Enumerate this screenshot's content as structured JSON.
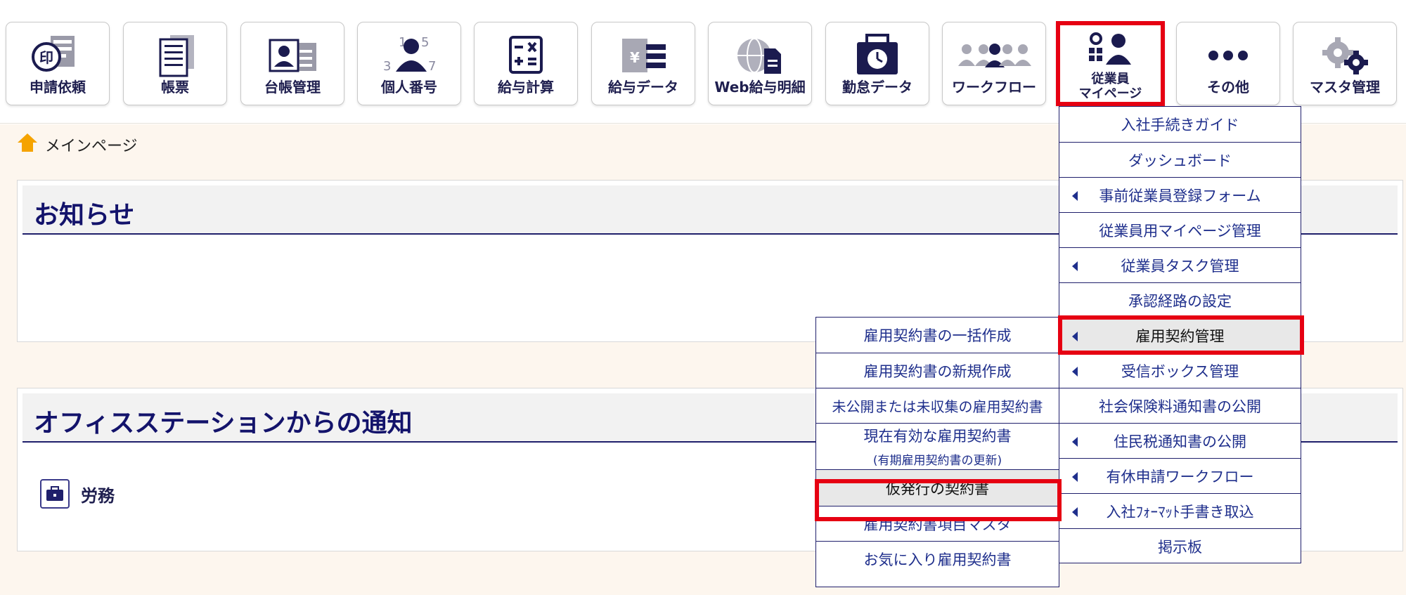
{
  "toolbar": {
    "tiles": [
      {
        "label": "申請依頼",
        "icon": "seal-document-icon"
      },
      {
        "label": "帳票",
        "icon": "document-icon"
      },
      {
        "label": "台帳管理",
        "icon": "id-card-icon"
      },
      {
        "label": "個人番号",
        "icon": "person-number-icon"
      },
      {
        "label": "給与計算",
        "icon": "calculator-icon"
      },
      {
        "label": "給与データ",
        "icon": "yen-data-icon"
      },
      {
        "label": "Web給与明細",
        "icon": "web-payslip-icon"
      },
      {
        "label": "勤怠データ",
        "icon": "timecard-icon"
      },
      {
        "label": "ワークフロー",
        "icon": "workflow-people-icon"
      },
      {
        "label_line1": "従業員",
        "label_line2": "マイページ",
        "icon": "employee-gear-icon"
      },
      {
        "label": "その他",
        "icon": "more-dots-icon"
      },
      {
        "label": "マスタ管理",
        "icon": "gears-icon"
      }
    ]
  },
  "breadcrumb": {
    "home_label": "メインページ"
  },
  "panels": {
    "notice_title": "お知らせ",
    "os_title": "オフィスステーションからの通知",
    "os_category": "労務"
  },
  "employee_menu": {
    "items": [
      {
        "label": "入社手続きガイド",
        "arrow": false
      },
      {
        "label": "ダッシュボード",
        "arrow": false
      },
      {
        "label": "事前従業員登録フォーム",
        "arrow": true
      },
      {
        "label": "従業員用マイページ管理",
        "arrow": false
      },
      {
        "label": "従業員タスク管理",
        "arrow": true
      },
      {
        "label": "承認経路の設定",
        "arrow": false
      },
      {
        "label": "雇用契約管理",
        "arrow": true,
        "highlighted": true
      },
      {
        "label": "受信ボックス管理",
        "arrow": true
      },
      {
        "label": "社会保険料通知書の公開",
        "arrow": false
      },
      {
        "label": "住民税通知書の公開",
        "arrow": true
      },
      {
        "label": "有休申請ワークフロー",
        "arrow": true
      },
      {
        "label": "入社ﾌｫｰﾏｯﾄ手書き取込",
        "arrow": true
      },
      {
        "label": "掲示板",
        "arrow": false
      }
    ]
  },
  "contract_menu": {
    "items": [
      {
        "label": "雇用契約書の一括作成"
      },
      {
        "label": "雇用契約書の新規作成"
      },
      {
        "label": "未公開または未収集の雇用契約書"
      },
      {
        "label": "現在有効な雇用契約書",
        "sub": "(有期雇用契約書の更新)"
      },
      {
        "label": "仮発行の契約書",
        "highlighted": true
      },
      {
        "label": "雇用契約書項目マスタ"
      },
      {
        "label": "お気に入り雇用契約書"
      }
    ]
  },
  "colors": {
    "accent_red": "#e60012",
    "navy": "#1f1f6b",
    "link_blue": "#1f2f8c",
    "home_icon": "#f5a300"
  }
}
